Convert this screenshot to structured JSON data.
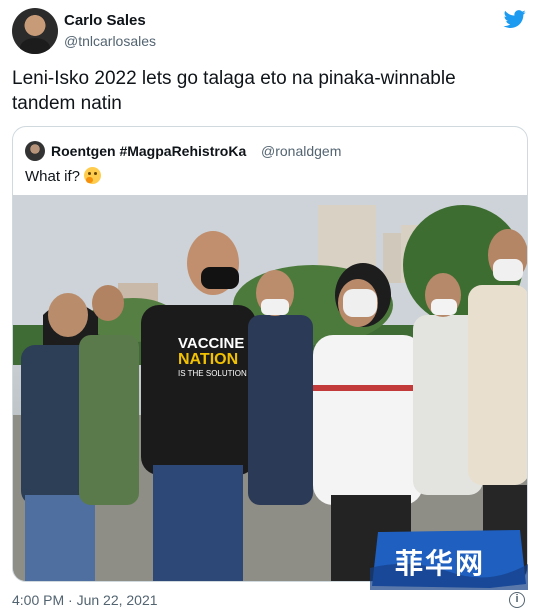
{
  "author": {
    "name": "Carlo Sales",
    "handle": "@tnlcarlosales"
  },
  "tweet": {
    "text": "Leni-Isko 2022 lets go talaga eto na pinaka-winnable tandem natin",
    "timestamp": "4:00 PM · Jun 22, 2021"
  },
  "quoted_tweet": {
    "name": "Roentgen #MagpaRehistroKa",
    "handle": "@ronaldgem",
    "text": "What if?",
    "emoji": "thinking-face-emoji",
    "photo": {
      "shirt_text_1": "VACCINE",
      "shirt_text_2": "NATION",
      "shirt_text_3": "IS THE SOLUTION"
    }
  },
  "icons": {
    "brand": "twitter-bird-icon",
    "info": "info-icon"
  },
  "watermark": {
    "text": "菲华网"
  },
  "colors": {
    "twitter_blue": "#1d9bf0",
    "secondary_text": "#536471",
    "border": "#cfd9de",
    "watermark_blue": "#1e5fbf"
  }
}
